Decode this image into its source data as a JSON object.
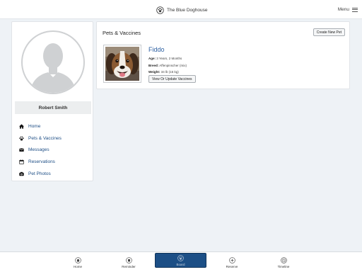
{
  "header": {
    "brand": "The Blue Doghouse",
    "brand_icon": "paw-circle-icon",
    "menu_label": "Menu",
    "menu_icon": "hamburger-icon"
  },
  "profile": {
    "name": "Robert Smith",
    "avatar_icon": "user-silhouette-icon"
  },
  "nav": {
    "items": [
      {
        "label": "Home",
        "icon": "home-icon"
      },
      {
        "label": "Pets & Vaccines",
        "icon": "paw-icon"
      },
      {
        "label": "Messages",
        "icon": "envelope-icon"
      },
      {
        "label": "Reservations",
        "icon": "calendar-icon"
      },
      {
        "label": "Pet Photos",
        "icon": "camera-icon"
      }
    ]
  },
  "pets": {
    "title": "Pets & Vaccines",
    "create_label": "Create New Pet",
    "pet": {
      "name": "Fiddo",
      "age_label": "Age:",
      "age_value": "3 Years, 2 Months",
      "breed_label": "Breed:",
      "breed_value": "Affenpinscher (mix)",
      "weight_label": "Weight:",
      "weight_value": "34 lb (15 kg)",
      "vaccines_label": "View Or Update Vaccines"
    }
  },
  "tabs": [
    {
      "label": "Home",
      "icon": "home-circle-icon",
      "active": false
    },
    {
      "label": "Reminder",
      "icon": "bell-circle-icon",
      "active": false
    },
    {
      "label": "Board",
      "icon": "paw-circle-icon",
      "active": true
    },
    {
      "label": "Reserve",
      "icon": "plus-circle-icon",
      "active": false
    },
    {
      "label": "Timeline",
      "icon": "clock-circle-icon",
      "active": false
    }
  ],
  "colors": {
    "accent": "#1c4f86",
    "link": "#1f4f86",
    "background": "#eef2f6"
  }
}
